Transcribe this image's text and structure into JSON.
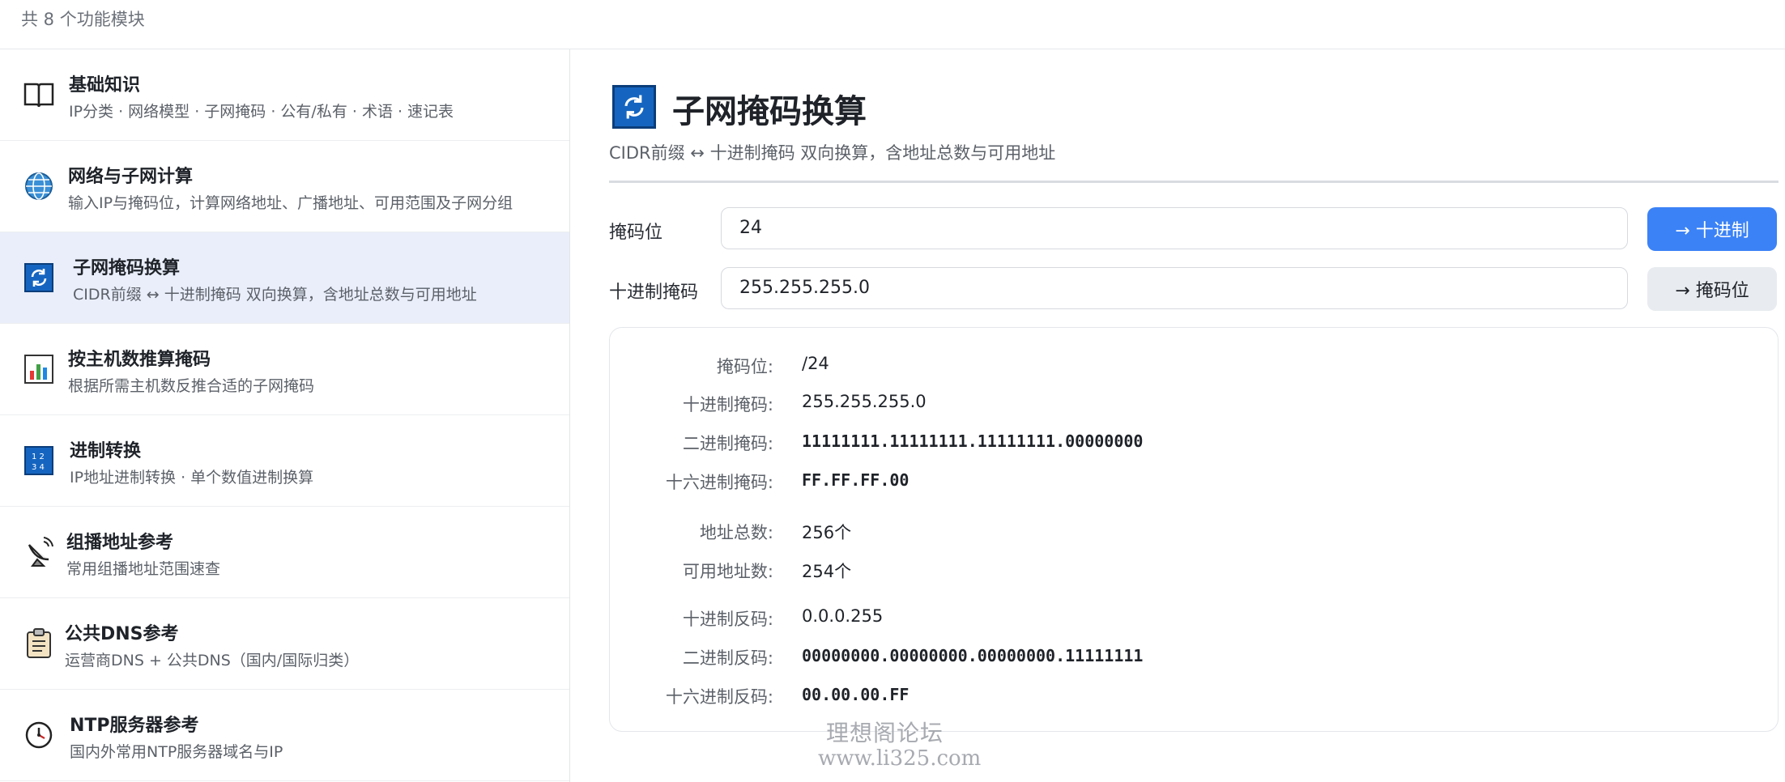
{
  "header": {
    "module_count": "共 8 个功能模块"
  },
  "sidebar": {
    "items": [
      {
        "title": "基础知识",
        "desc": "IP分类 · 网络模型 · 子网掩码 · 公有/私有 · 术语 · 速记表",
        "icon": "book-icon"
      },
      {
        "title": "网络与子网计算",
        "desc": "输入IP与掩码位，计算网络地址、广播地址、可用范围及子网分组",
        "icon": "globe-icon"
      },
      {
        "title": "子网掩码换算",
        "desc": "CIDR前缀 ↔ 十进制掩码 双向换算，含地址总数与可用地址",
        "icon": "refresh-icon",
        "active": true
      },
      {
        "title": "按主机数推算掩码",
        "desc": "根据所需主机数反推合适的子网掩码",
        "icon": "bar-chart-icon"
      },
      {
        "title": "进制转换",
        "desc": "IP地址进制转换 · 单个数值进制换算",
        "icon": "numbers-icon"
      },
      {
        "title": "组播地址参考",
        "desc": "常用组播地址范围速查",
        "icon": "satellite-icon"
      },
      {
        "title": "公共DNS参考",
        "desc": "运营商DNS + 公共DNS（国内/国际归类）",
        "icon": "clipboard-icon"
      },
      {
        "title": "NTP服务器参考",
        "desc": "国内外常用NTP服务器域名与IP",
        "icon": "clock-icon"
      }
    ]
  },
  "main": {
    "title": "子网掩码换算",
    "subtitle": "CIDR前缀 ↔ 十进制掩码 双向换算，含地址总数与可用地址",
    "icon": "refresh-icon",
    "inputs": {
      "prefix_label": "掩码位",
      "prefix_value": "24",
      "to_decimal_button": "→ 十进制",
      "decimal_label": "十进制掩码",
      "decimal_value": "255.255.255.0",
      "to_prefix_button": "→ 掩码位"
    },
    "results": [
      {
        "label": "掩码位:",
        "value": "/24",
        "mono": false
      },
      {
        "label": "十进制掩码:",
        "value": "255.255.255.0",
        "mono": false
      },
      {
        "label": "二进制掩码:",
        "value": "11111111.11111111.11111111.00000000",
        "mono": true
      },
      {
        "label": "十六进制掩码:",
        "value": "FF.FF.FF.00",
        "mono": true
      },
      {
        "label": "地址总数:",
        "value": "256个",
        "mono": false
      },
      {
        "label": "可用地址数:",
        "value": "254个",
        "mono": false
      },
      {
        "label": "十进制反码:",
        "value": "0.0.0.255",
        "mono": false
      },
      {
        "label": "二进制反码:",
        "value": "00000000.00000000.00000000.11111111",
        "mono": true
      },
      {
        "label": "十六进制反码:",
        "value": "00.00.00.FF",
        "mono": true
      }
    ]
  },
  "watermark": {
    "line1": "理想阁论坛",
    "line2": "www.li325.com"
  },
  "colors": {
    "accent": "#3b82f6",
    "active_bg": "#e9eefa",
    "icon_blue": "#1565c0"
  }
}
